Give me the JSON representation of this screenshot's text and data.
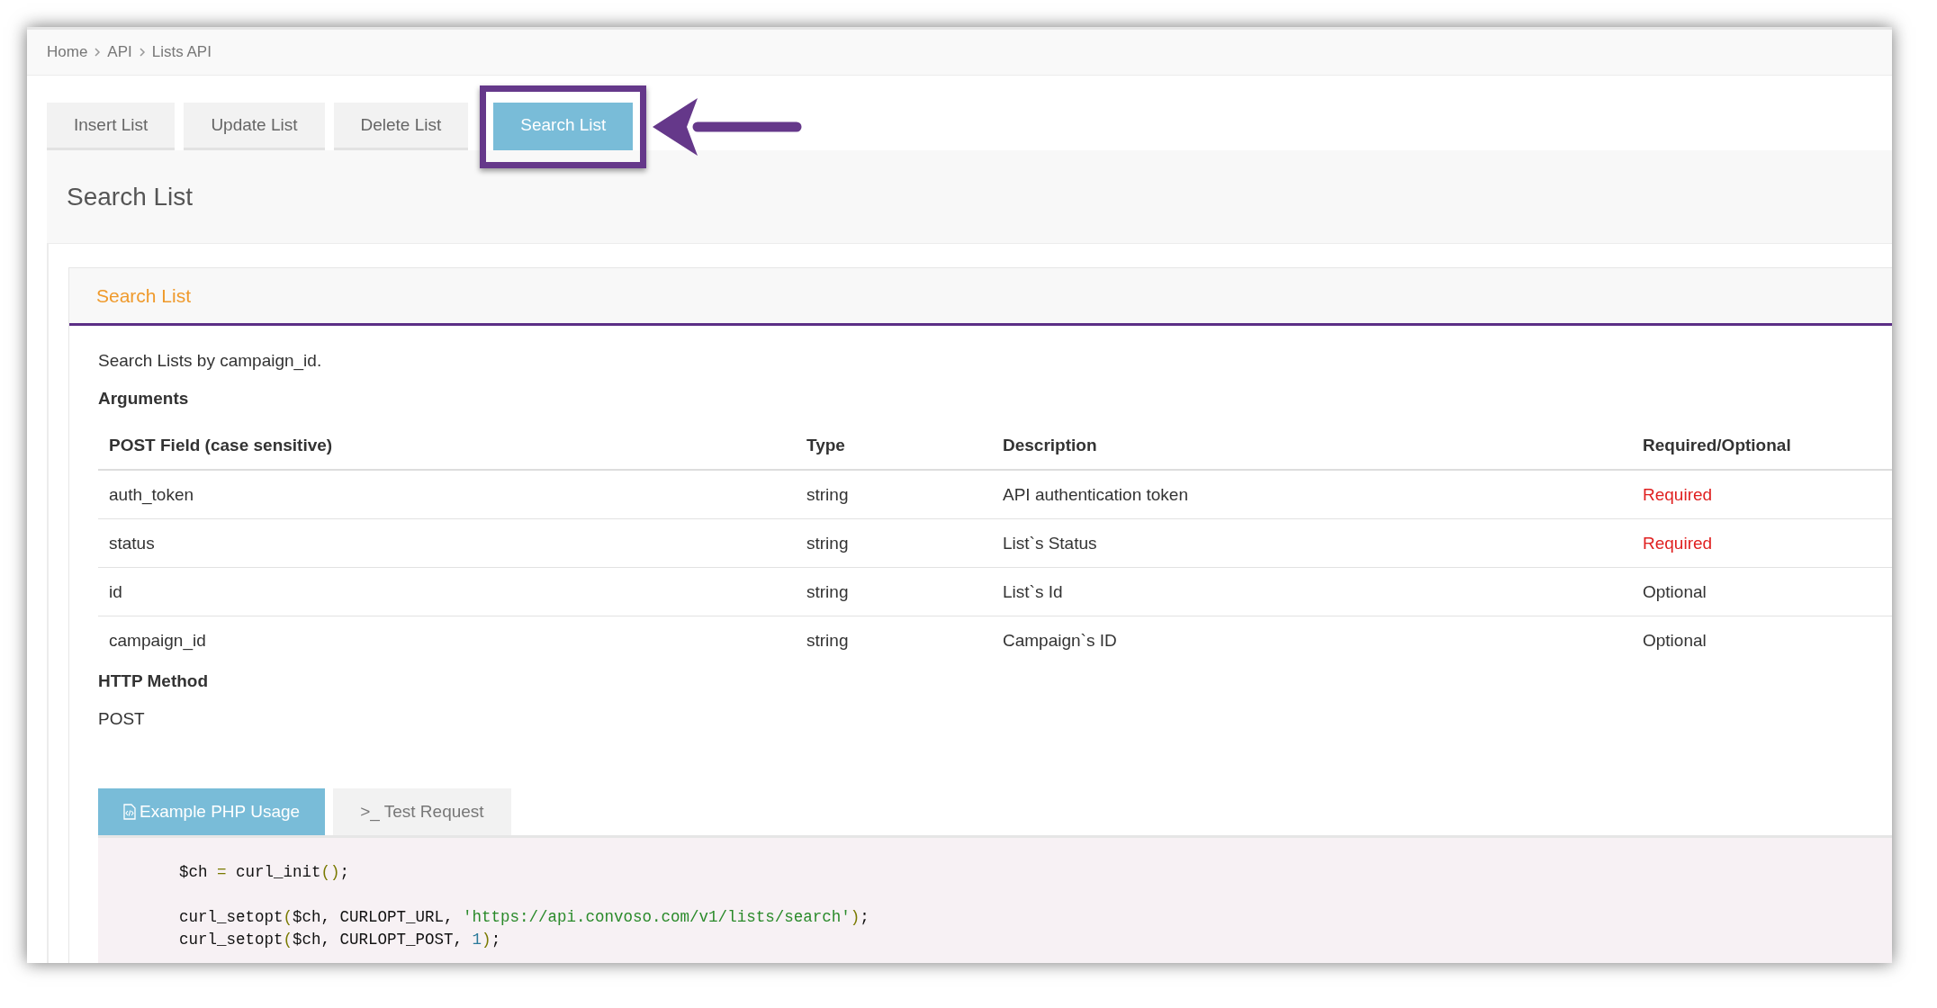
{
  "breadcrumb": [
    "Home",
    "API",
    "Lists API"
  ],
  "tabs": [
    {
      "label": "Insert List",
      "selected": false
    },
    {
      "label": "Update List",
      "selected": false
    },
    {
      "label": "Delete List",
      "selected": false
    },
    {
      "label": "Search List",
      "selected": true
    }
  ],
  "page_title": "Search List",
  "panel": {
    "title": "Search List",
    "description": "Search Lists by campaign_id.",
    "arguments_heading": "Arguments",
    "table": {
      "columns": [
        "POST Field (case sensitive)",
        "Type",
        "Description",
        "Required/Optional"
      ],
      "rows": [
        {
          "field": "auth_token",
          "type": "string",
          "description": "API authentication token",
          "requirement": "Required",
          "required": true
        },
        {
          "field": "status",
          "type": "string",
          "description": "List`s Status",
          "requirement": "Required",
          "required": true
        },
        {
          "field": "id",
          "type": "string",
          "description": "List`s Id",
          "requirement": "Optional",
          "required": false
        },
        {
          "field": "campaign_id",
          "type": "string",
          "description": "Campaign`s ID",
          "requirement": "Optional",
          "required": false
        }
      ]
    },
    "method_heading": "HTTP Method",
    "method": "POST",
    "code_tabs": [
      {
        "label": "Example PHP Usage",
        "selected": true
      },
      {
        "label": ">_ Test Request",
        "selected": false
      }
    ],
    "code_lines": [
      [
        {
          "kind": "plain",
          "text": "$ch "
        },
        {
          "kind": "op",
          "text": "="
        },
        {
          "kind": "plain",
          "text": " curl_init"
        },
        {
          "kind": "op",
          "text": "()"
        },
        {
          "kind": "plain",
          "text": ";"
        }
      ],
      [
        {
          "kind": "plain",
          "text": "curl_setopt"
        },
        {
          "kind": "op",
          "text": "("
        },
        {
          "kind": "plain",
          "text": "$ch, CURLOPT_URL, "
        },
        {
          "kind": "string",
          "text": "'https://api.convoso.com/v1/lists/search'"
        },
        {
          "kind": "op",
          "text": ")"
        },
        {
          "kind": "plain",
          "text": ";"
        }
      ],
      [
        {
          "kind": "plain",
          "text": "curl_setopt"
        },
        {
          "kind": "op",
          "text": "("
        },
        {
          "kind": "plain",
          "text": "$ch, CURLOPT_POST, "
        },
        {
          "kind": "number",
          "text": "1"
        },
        {
          "kind": "op",
          "text": ")"
        },
        {
          "kind": "plain",
          "text": ";"
        }
      ]
    ]
  }
}
